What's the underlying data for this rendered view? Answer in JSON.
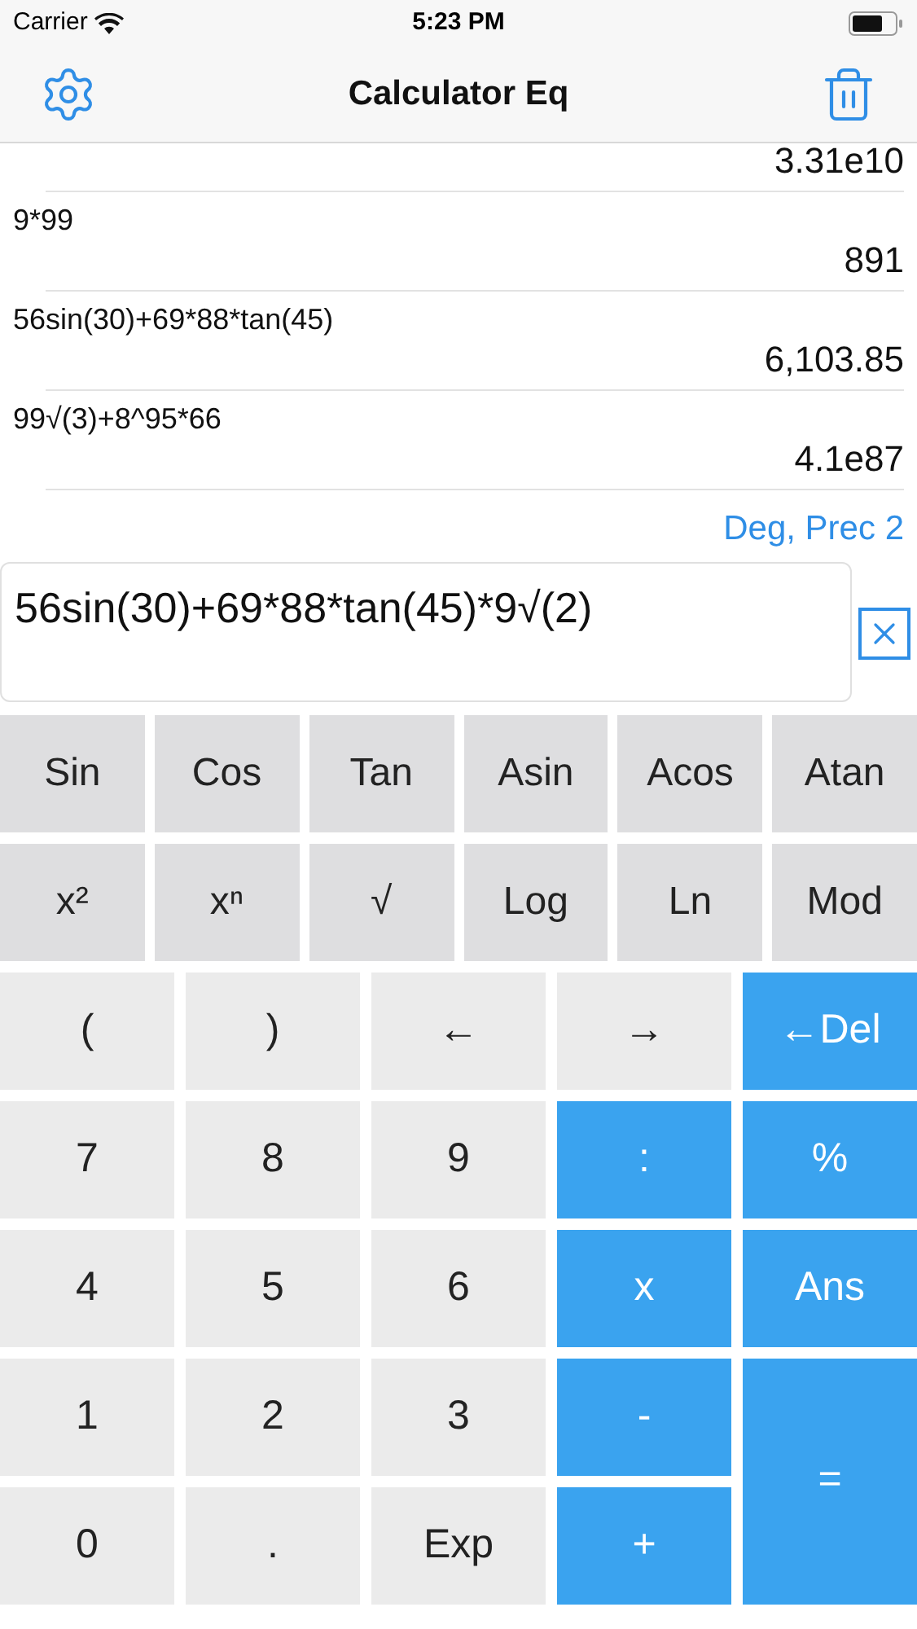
{
  "status_bar": {
    "carrier": "Carrier",
    "time": "5:23 PM"
  },
  "nav_bar": {
    "title": "Calculator Eq"
  },
  "history": [
    {
      "result": "3.31e10"
    },
    {
      "expression": "9*99",
      "result": "891"
    },
    {
      "expression": "56sin(30)+69*88*tan(45)",
      "result": "6,103.85"
    },
    {
      "expression": "99√(3)+8^95*66",
      "result": "4.1e87"
    }
  ],
  "mode": "Deg, Prec 2",
  "input": {
    "value": "56sin(30)+69*88*tan(45)*9√(2)"
  },
  "function_keys": [
    [
      "Sin",
      "Cos",
      "Tan",
      "Asin",
      "Acos",
      "Atan"
    ],
    [
      "x²",
      "xⁿ",
      "√",
      "Log",
      "Ln",
      "Mod"
    ]
  ],
  "keys": [
    {
      "label": "(",
      "kind": "digit"
    },
    {
      "label": ")",
      "kind": "digit"
    },
    {
      "label": "←",
      "kind": "digit"
    },
    {
      "label": "→",
      "kind": "digit"
    },
    {
      "label": "←Del",
      "kind": "operator"
    },
    {
      "label": "7",
      "kind": "digit"
    },
    {
      "label": "8",
      "kind": "digit"
    },
    {
      "label": "9",
      "kind": "digit"
    },
    {
      "label": ":",
      "kind": "operator"
    },
    {
      "label": "%",
      "kind": "operator"
    },
    {
      "label": "4",
      "kind": "digit"
    },
    {
      "label": "5",
      "kind": "digit"
    },
    {
      "label": "6",
      "kind": "digit"
    },
    {
      "label": "x",
      "kind": "operator"
    },
    {
      "label": "Ans",
      "kind": "operator"
    },
    {
      "label": "1",
      "kind": "digit"
    },
    {
      "label": "2",
      "kind": "digit"
    },
    {
      "label": "3",
      "kind": "digit"
    },
    {
      "label": "-",
      "kind": "operator"
    },
    {
      "label": "=",
      "kind": "equals"
    },
    {
      "label": "0",
      "kind": "digit"
    },
    {
      "label": ".",
      "kind": "digit"
    },
    {
      "label": "Exp",
      "kind": "digit"
    },
    {
      "label": "+",
      "kind": "operator"
    }
  ]
}
